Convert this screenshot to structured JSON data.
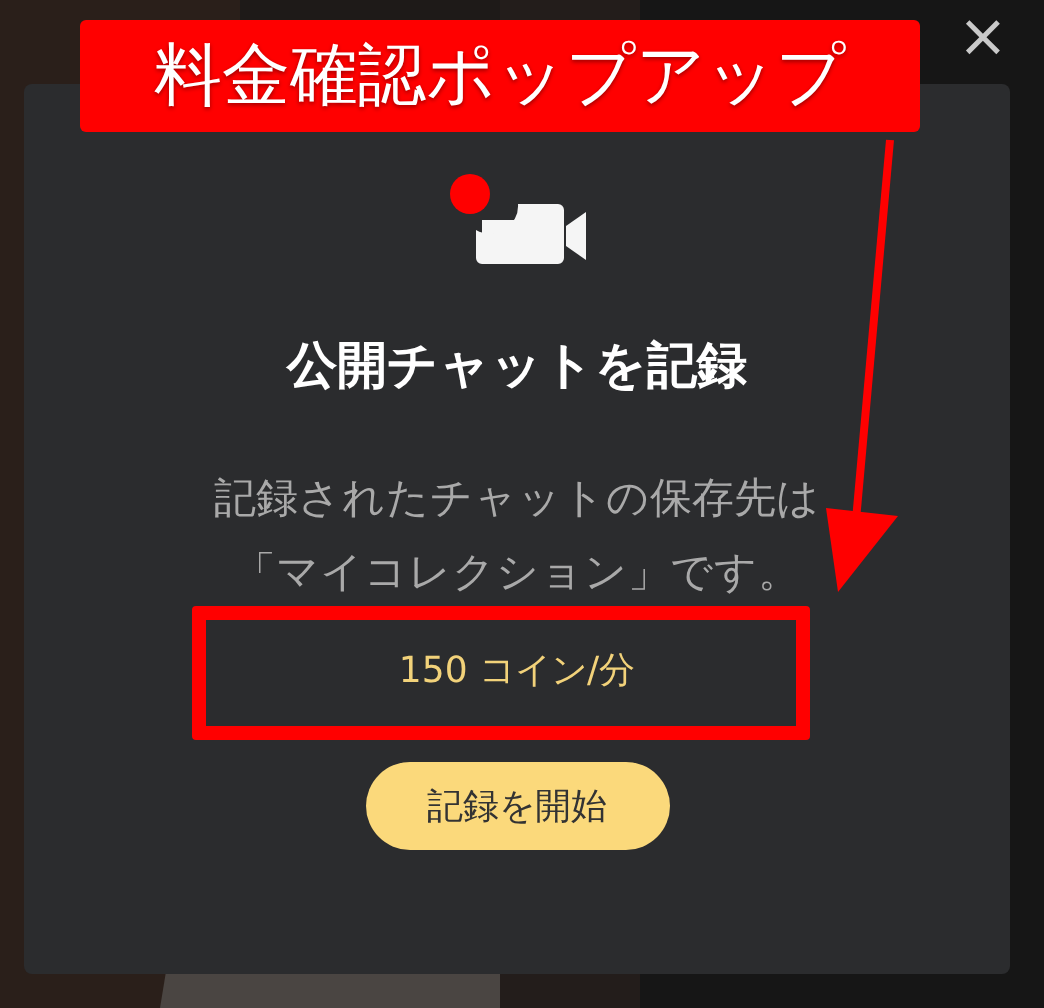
{
  "dialog": {
    "title": "公開チャットを記録",
    "description": "記録されたチャットの保存先は「マイコレクション」です。",
    "price": "150 コイン/分",
    "button": "記録を開始",
    "close": "×",
    "recording": true
  },
  "annotation": {
    "label": "料金確認ポップアップ",
    "highlight": true,
    "arrow": true
  }
}
